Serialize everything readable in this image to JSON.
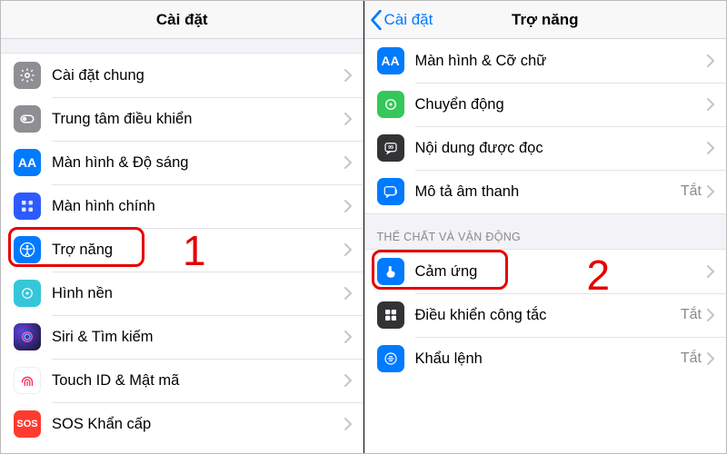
{
  "left": {
    "title": "Cài đặt",
    "rows": [
      {
        "name": "general",
        "label": "Cài đặt chung",
        "icon": "gear-icon"
      },
      {
        "name": "control-center",
        "label": "Trung tâm điều khiển",
        "icon": "controlcenter-icon"
      },
      {
        "name": "display",
        "label": "Màn hình & Độ sáng",
        "icon": "display-icon"
      },
      {
        "name": "homescreen",
        "label": "Màn hình chính",
        "icon": "homescreen-icon"
      },
      {
        "name": "accessibility",
        "label": "Trợ năng",
        "icon": "accessibility-icon"
      },
      {
        "name": "wallpaper",
        "label": "Hình nền",
        "icon": "wallpaper-icon"
      },
      {
        "name": "siri",
        "label": "Siri & Tìm kiếm",
        "icon": "siri-icon"
      },
      {
        "name": "touchid",
        "label": "Touch ID & Mật mã",
        "icon": "touchid-icon"
      },
      {
        "name": "sos",
        "label": "SOS Khẩn cấp",
        "icon": "sos-icon"
      }
    ],
    "annotation": "1"
  },
  "right": {
    "title": "Trợ năng",
    "back_label": "Cài đặt",
    "section_label": "THỂ CHẤT VÀ VẬN ĐỘNG",
    "group1": [
      {
        "name": "display-text",
        "label": "Màn hình & Cỡ chữ",
        "icon": "aa-icon",
        "value": ""
      },
      {
        "name": "motion",
        "label": "Chuyển động",
        "icon": "motion-icon",
        "value": ""
      },
      {
        "name": "spoken",
        "label": "Nội dung được đọc",
        "icon": "spoken-icon",
        "value": ""
      },
      {
        "name": "audio-desc",
        "label": "Mô tả âm thanh",
        "icon": "audiodesc-icon",
        "value": "Tắt"
      }
    ],
    "group2": [
      {
        "name": "touch",
        "label": "Cảm ứng",
        "icon": "touch-icon",
        "value": ""
      },
      {
        "name": "switch-control",
        "label": "Điều khiển công tắc",
        "icon": "switch-icon",
        "value": "Tắt"
      },
      {
        "name": "voice-control",
        "label": "Khẩu lệnh",
        "icon": "voice-icon",
        "value": "Tắt"
      }
    ],
    "annotation": "2"
  }
}
